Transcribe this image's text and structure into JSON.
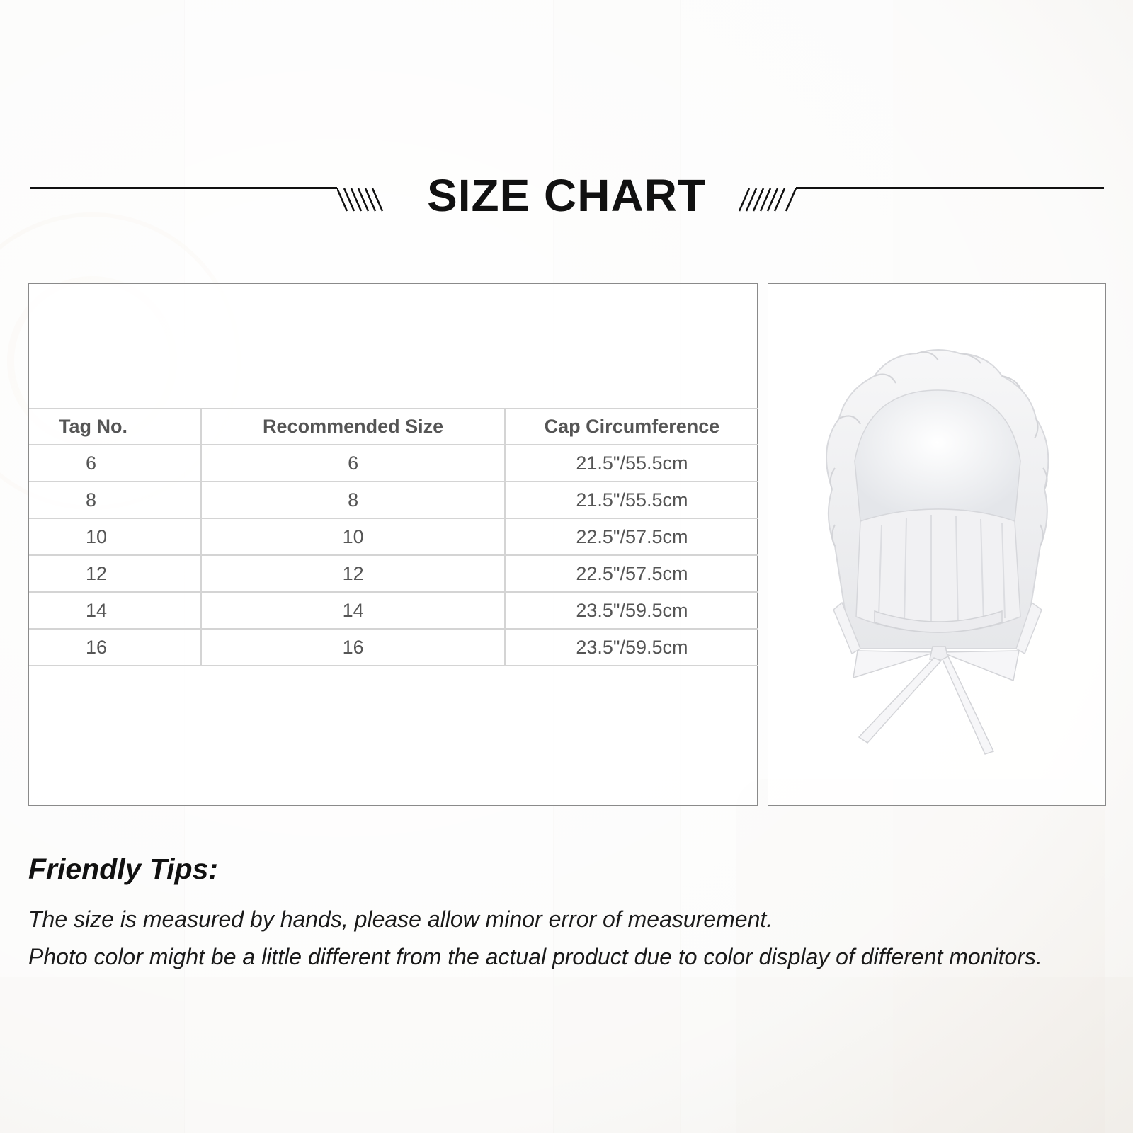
{
  "header": {
    "title": "SIZE CHART"
  },
  "size_table": {
    "columns": [
      "Tag No.",
      "Recommended Size",
      "Cap Circumference"
    ],
    "rows": [
      [
        "6",
        "6",
        "21.5\"/55.5cm"
      ],
      [
        "8",
        "8",
        "21.5\"/55.5cm"
      ],
      [
        "10",
        "10",
        "22.5\"/57.5cm"
      ],
      [
        "12",
        "12",
        "22.5\"/57.5cm"
      ],
      [
        "14",
        "14",
        "23.5\"/59.5cm"
      ],
      [
        "16",
        "16",
        "23.5\"/59.5cm"
      ]
    ]
  },
  "tips": {
    "title": "Friendly Tips:",
    "lines": [
      "The size is measured by hands, please allow minor error of measurement.",
      "Photo color might be a little different from the actual product due to color display of different monitors."
    ]
  },
  "colors": {
    "text": "#111111",
    "table_text": "#555555",
    "table_lines": "#d4d4d4",
    "box_border": "#8a8a8a"
  }
}
